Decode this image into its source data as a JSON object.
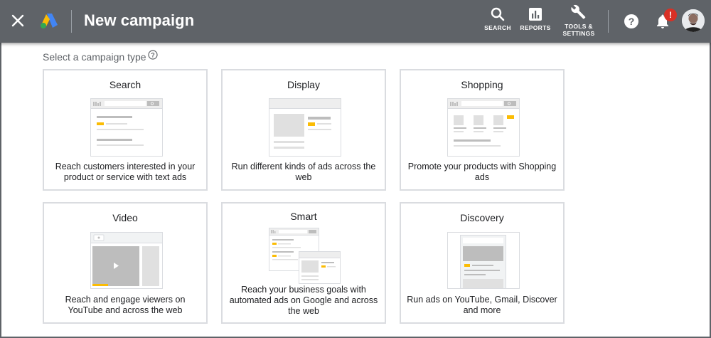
{
  "topbar": {
    "title": "New campaign",
    "search_label": "SEARCH",
    "reports_label": "REPORTS",
    "tools_label_line1": "TOOLS &",
    "tools_label_line2": "SETTINGS",
    "notification_badge": "!",
    "background_color": "#5f6368",
    "badge_color": "#d93025"
  },
  "main": {
    "section_label": "Select a campaign type",
    "cards": [
      {
        "title": "Search",
        "description": "Reach customers interested in your product or service with text ads"
      },
      {
        "title": "Display",
        "description": "Run different kinds of ads across the web"
      },
      {
        "title": "Shopping",
        "description": "Promote your products with Shopping ads"
      },
      {
        "title": "Video",
        "description": "Reach and engage viewers on YouTube and across the web"
      },
      {
        "title": "Smart",
        "description": "Reach your business goals with automated ads on Google and across the web"
      },
      {
        "title": "Discovery",
        "description": "Run ads on YouTube, Gmail, Discover and more"
      }
    ]
  },
  "icons": {
    "close": "close-icon",
    "logo": "google-ads-logo",
    "search": "search-icon",
    "reports": "bar-chart-icon",
    "tools": "wrench-icon",
    "help": "help-icon",
    "notifications": "bell-icon",
    "avatar": "avatar"
  },
  "colors": {
    "accent_yellow": "#fbbc04",
    "card_border": "#dadce0",
    "illustration_gray": "#e0e0e0"
  }
}
